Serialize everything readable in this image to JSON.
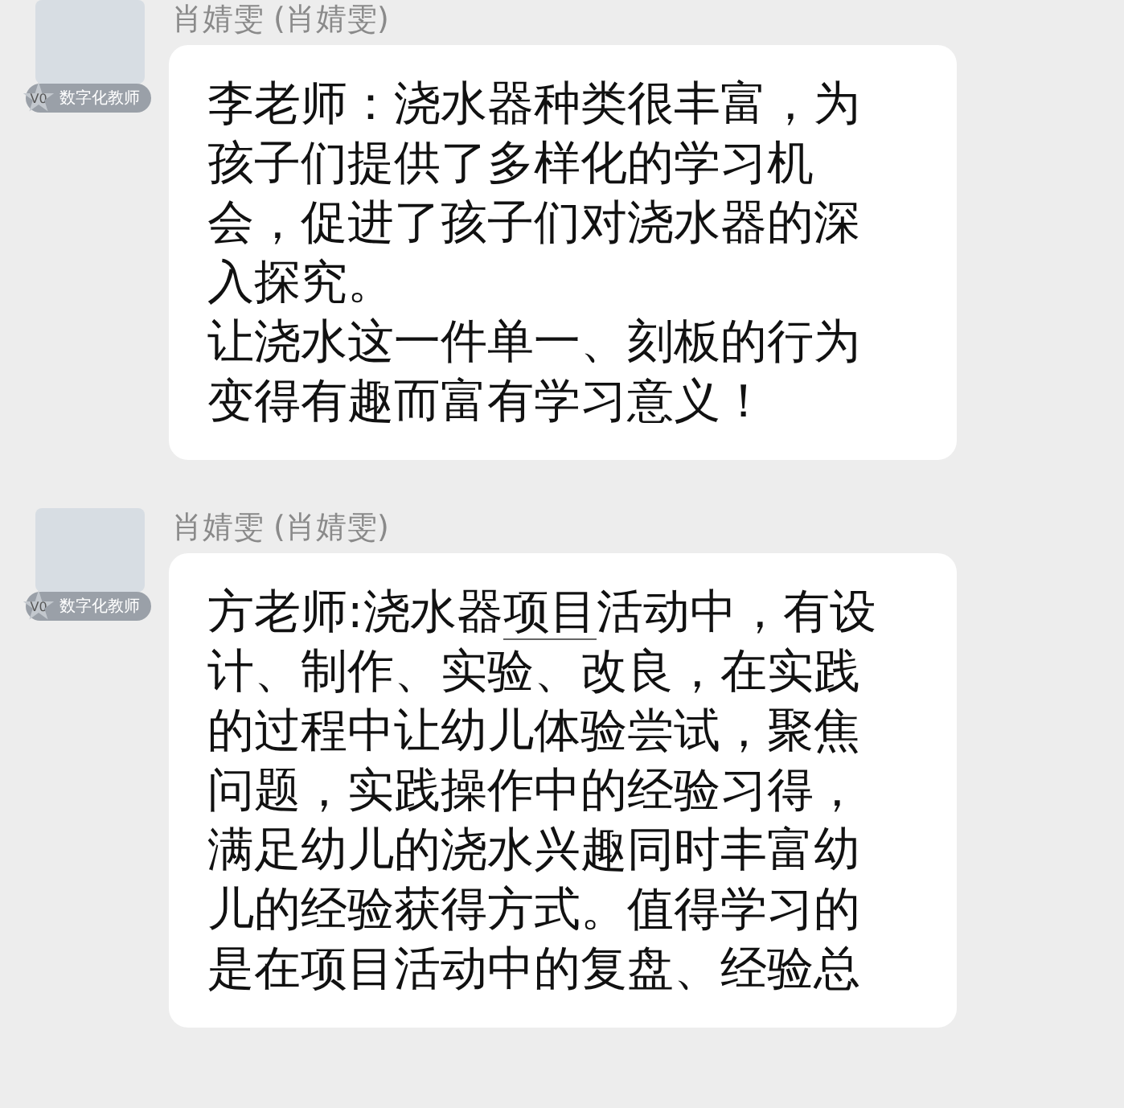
{
  "messages": [
    {
      "sender": "肖婧雯 (肖婧雯)",
      "badge": {
        "level": "V0",
        "title": "数字化教师"
      },
      "paragraphs": [
        [
          {
            "text": "李老师：浇水器种类很丰富，为孩子们提供了多样化的学习机会，促进了孩子们对浇水器的深入探究。",
            "underlined": false
          }
        ],
        [
          {
            "text": "让浇水这一件单一、刻板的行为变得有趣而富有学习意义！",
            "underlined": false
          }
        ]
      ]
    },
    {
      "sender": "肖婧雯 (肖婧雯)",
      "badge": {
        "level": "V0",
        "title": "数字化教师"
      },
      "paragraphs": [
        [
          {
            "text": "方老师:浇水器",
            "underlined": false
          },
          {
            "text": "项目",
            "underlined": true
          },
          {
            "text": "活动中，有设计、制作、实验、改良，在实践的过程中让幼儿体验尝试，聚焦问题，实践操作中的经验习得，满足幼儿的浇水兴趣同时丰富幼儿的经验获得方式。值得学习的是在项目活动中的复盘、经验总",
            "underlined": false
          }
        ]
      ]
    }
  ]
}
